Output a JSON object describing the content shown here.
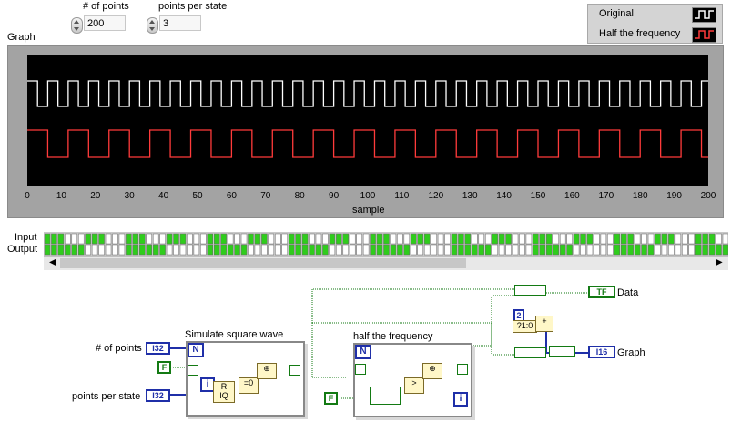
{
  "controls": {
    "num_points": {
      "label": "# of points",
      "value": "200"
    },
    "points_per_state": {
      "label": "points per state",
      "value": "3"
    }
  },
  "graph": {
    "title": "Graph",
    "xlabel": "sample",
    "legend": [
      {
        "label": "Original",
        "color": "#ffffff"
      },
      {
        "label": "Half the frequency",
        "color": "#ff3b3b"
      }
    ],
    "xticks": [
      "0",
      "10",
      "20",
      "30",
      "40",
      "50",
      "60",
      "70",
      "80",
      "90",
      "100",
      "110",
      "120",
      "130",
      "140",
      "150",
      "160",
      "170",
      "180",
      "190",
      "200"
    ]
  },
  "bool_array": {
    "row1_label": "Input",
    "row2_label": "Output"
  },
  "diagram": {
    "loop1_title": "Simulate square wave",
    "loop2_title": "half the frequency",
    "num_points_label": "# of points",
    "points_per_state_label": "points per state",
    "data_label": "Data",
    "graph_label": "Graph",
    "i32_tag": "I32",
    "i16_tag": "I16",
    "tf_tag": "TF",
    "false_const": "F",
    "two_const": "2",
    "n_label": "N",
    "i_label": "i",
    "r_label": "R",
    "q_label": "IQ",
    "eq0_label": "=0",
    "sel_label": "?1:0"
  },
  "chart_data": {
    "type": "line",
    "title": "Graph",
    "xlabel": "sample",
    "ylabel": "",
    "xlim": [
      0,
      200
    ],
    "grid": false,
    "legend_position": "top-right",
    "series": [
      {
        "name": "Original",
        "period": 6,
        "duty": 3,
        "color": "#ffffff"
      },
      {
        "name": "Half the frequency",
        "period": 12,
        "duty": 6,
        "color": "#ff3b3b"
      }
    ]
  }
}
